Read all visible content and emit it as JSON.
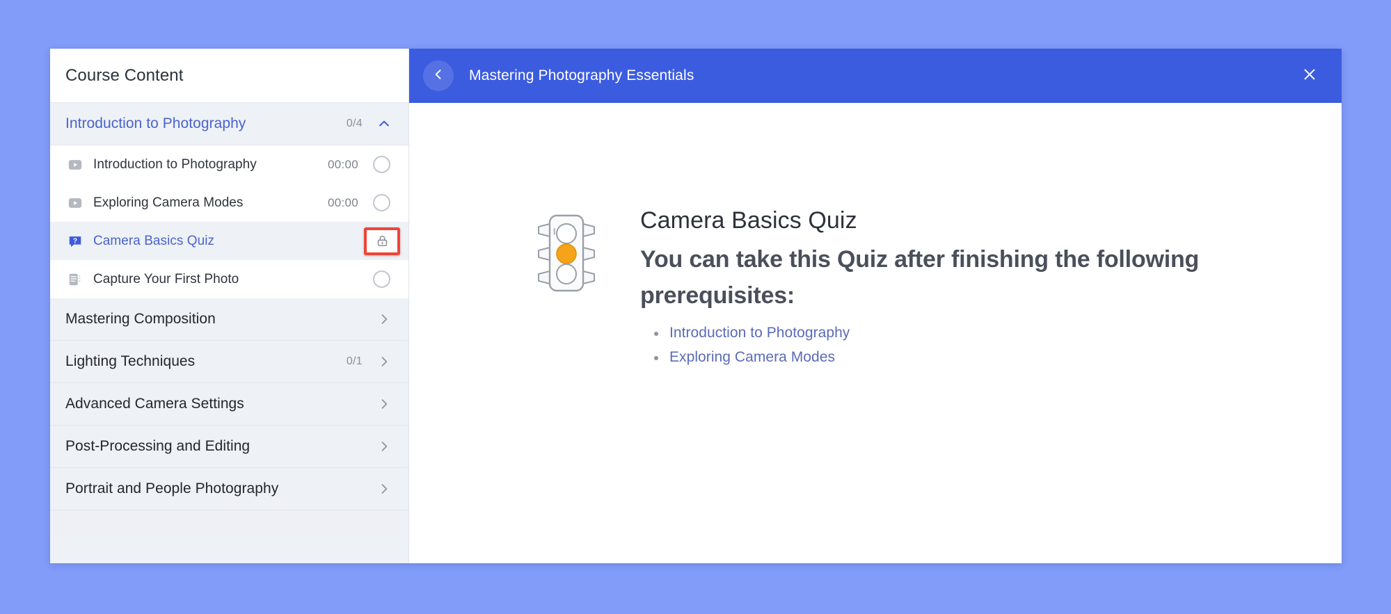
{
  "theme": {
    "page_bg": "#829cfa",
    "header_blue": "#3c5ce0",
    "accent_blue": "#4a63cf",
    "link_blue": "#5a6bb8",
    "sidebar_bg": "#eef1f5",
    "highlight_red": "#f04438",
    "signal_amber": "#f5a318"
  },
  "sidebar": {
    "title": "Course Content",
    "sections": [
      {
        "label": "Introduction to Photography",
        "count": "0/4",
        "expanded": true,
        "chevron_icon": "chevron-up-icon",
        "lessons": [
          {
            "label": "Introduction to Photography",
            "icon": "video-icon",
            "time": "00:00",
            "status": "circle-outline-icon",
            "selected": false,
            "locked": false
          },
          {
            "label": "Exploring Camera Modes",
            "icon": "video-icon",
            "time": "00:00",
            "status": "circle-outline-icon",
            "selected": false,
            "locked": false
          },
          {
            "label": "Camera Basics Quiz",
            "icon": "quiz-icon",
            "time": "",
            "status": "lock-icon",
            "selected": true,
            "locked": true
          },
          {
            "label": "Capture Your First Photo",
            "icon": "assignment-icon",
            "time": "",
            "status": "circle-outline-icon",
            "selected": false,
            "locked": false
          }
        ]
      },
      {
        "label": "Mastering Composition",
        "count": "",
        "expanded": false,
        "chevron_icon": "chevron-right-icon",
        "lessons": []
      },
      {
        "label": "Lighting Techniques",
        "count": "0/1",
        "expanded": false,
        "chevron_icon": "chevron-right-icon",
        "lessons": []
      },
      {
        "label": "Advanced Camera Settings",
        "count": "",
        "expanded": false,
        "chevron_icon": "chevron-right-icon",
        "lessons": []
      },
      {
        "label": "Post-Processing and Editing",
        "count": "",
        "expanded": false,
        "chevron_icon": "chevron-right-icon",
        "lessons": []
      },
      {
        "label": "Portrait and People Photography",
        "count": "",
        "expanded": false,
        "chevron_icon": "chevron-right-icon",
        "lessons": []
      }
    ]
  },
  "main": {
    "header": {
      "title": "Mastering Photography Essentials",
      "back_icon": "chevron-left-icon",
      "close_icon": "close-icon"
    },
    "content": {
      "signal_icon": "traffic-light-icon",
      "quiz_name": "Camera Basics Quiz",
      "message": "You can take this Quiz after finishing the following prerequisites:",
      "prerequisites": [
        "Introduction to Photography",
        "Exploring Camera Modes"
      ]
    }
  }
}
